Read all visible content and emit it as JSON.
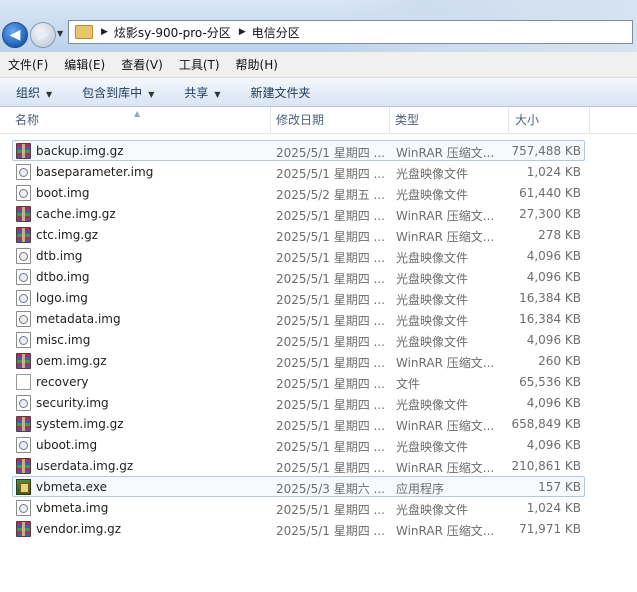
{
  "address": {
    "crumbs": [
      "炫影sy-900-pro-分区",
      "电信分区"
    ],
    "sep": "▶"
  },
  "menu": [
    "文件(F)",
    "编辑(E)",
    "查看(V)",
    "工具(T)",
    "帮助(H)"
  ],
  "toolbar": [
    {
      "label": "组织",
      "has_caret": true
    },
    {
      "label": "包含到库中",
      "has_caret": true
    },
    {
      "label": "共享",
      "has_caret": true
    },
    {
      "label": "新建文件夹",
      "has_caret": false
    }
  ],
  "columns": {
    "name": "名称",
    "date": "修改日期",
    "type": "类型",
    "size": "大小"
  },
  "files": [
    {
      "name": "backup.img.gz",
      "date": "2025/5/1 星期四 ...",
      "type": "WinRAR 压缩文...",
      "size": "757,488 KB",
      "icon": "rar-archive-icon",
      "selected": true
    },
    {
      "name": "baseparameter.img",
      "date": "2025/5/1 星期四 ...",
      "type": "光盘映像文件",
      "size": "1,024 KB",
      "icon": "disc-image-icon"
    },
    {
      "name": "boot.img",
      "date": "2025/5/2 星期五 ...",
      "type": "光盘映像文件",
      "size": "61,440 KB",
      "icon": "disc-image-icon"
    },
    {
      "name": "cache.img.gz",
      "date": "2025/5/1 星期四 ...",
      "type": "WinRAR 压缩文...",
      "size": "27,300 KB",
      "icon": "rar-archive-icon"
    },
    {
      "name": "ctc.img.gz",
      "date": "2025/5/1 星期四 ...",
      "type": "WinRAR 压缩文...",
      "size": "278 KB",
      "icon": "rar-archive-icon"
    },
    {
      "name": "dtb.img",
      "date": "2025/5/1 星期四 ...",
      "type": "光盘映像文件",
      "size": "4,096 KB",
      "icon": "disc-image-icon"
    },
    {
      "name": "dtbo.img",
      "date": "2025/5/1 星期四 ...",
      "type": "光盘映像文件",
      "size": "4,096 KB",
      "icon": "disc-image-icon"
    },
    {
      "name": "logo.img",
      "date": "2025/5/1 星期四 ...",
      "type": "光盘映像文件",
      "size": "16,384 KB",
      "icon": "disc-image-icon"
    },
    {
      "name": "metadata.img",
      "date": "2025/5/1 星期四 ...",
      "type": "光盘映像文件",
      "size": "16,384 KB",
      "icon": "disc-image-icon"
    },
    {
      "name": "misc.img",
      "date": "2025/5/1 星期四 ...",
      "type": "光盘映像文件",
      "size": "4,096 KB",
      "icon": "disc-image-icon"
    },
    {
      "name": "oem.img.gz",
      "date": "2025/5/1 星期四 ...",
      "type": "WinRAR 压缩文...",
      "size": "260 KB",
      "icon": "rar-archive-icon"
    },
    {
      "name": "recovery",
      "date": "2025/5/1 星期四 ...",
      "type": "文件",
      "size": "65,536 KB",
      "icon": "blank-file-icon"
    },
    {
      "name": "security.img",
      "date": "2025/5/1 星期四 ...",
      "type": "光盘映像文件",
      "size": "4,096 KB",
      "icon": "disc-image-icon"
    },
    {
      "name": "system.img.gz",
      "date": "2025/5/1 星期四 ...",
      "type": "WinRAR 压缩文...",
      "size": "658,849 KB",
      "icon": "rar-archive-icon"
    },
    {
      "name": "uboot.img",
      "date": "2025/5/1 星期四 ...",
      "type": "光盘映像文件",
      "size": "4,096 KB",
      "icon": "disc-image-icon"
    },
    {
      "name": "userdata.img.gz",
      "date": "2025/5/1 星期四 ...",
      "type": "WinRAR 压缩文...",
      "size": "210,861 KB",
      "icon": "rar-archive-icon"
    },
    {
      "name": "vbmeta.exe",
      "date": "2025/5/3 星期六 ...",
      "type": "应用程序",
      "size": "157 KB",
      "icon": "exe-application-icon",
      "selected": true
    },
    {
      "name": "vbmeta.img",
      "date": "2025/5/1 星期四 ...",
      "type": "光盘映像文件",
      "size": "1,024 KB",
      "icon": "disc-image-icon"
    },
    {
      "name": "vendor.img.gz",
      "date": "2025/5/1 星期四 ...",
      "type": "WinRAR 压缩文...",
      "size": "71,971 KB",
      "icon": "rar-archive-icon"
    }
  ]
}
